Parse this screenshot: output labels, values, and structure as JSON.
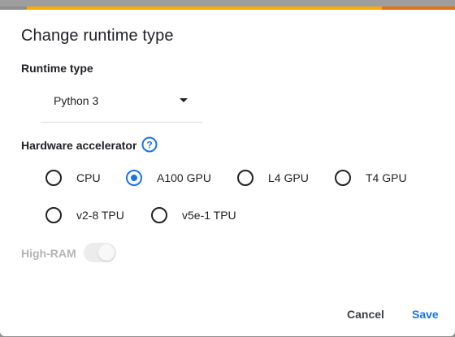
{
  "dialog": {
    "title": "Change runtime type",
    "runtime_label": "Runtime type",
    "runtime_value": "Python 3",
    "accelerator_label": "Hardware accelerator",
    "accelerators": [
      {
        "label": "CPU",
        "checked": false
      },
      {
        "label": "A100 GPU",
        "checked": true
      },
      {
        "label": "L4 GPU",
        "checked": false
      },
      {
        "label": "T4 GPU",
        "checked": false
      },
      {
        "label": "v2-8 TPU",
        "checked": false
      },
      {
        "label": "v5e-1 TPU",
        "checked": false
      }
    ],
    "high_ram_label": "High-RAM",
    "high_ram_enabled": false,
    "cancel_label": "Cancel",
    "save_label": "Save"
  },
  "colors": {
    "accent": "#1a73e8",
    "top_bar_yellow": "#f9ab00",
    "top_bar_orange": "#e8710a"
  },
  "icons": {
    "help": "help-circle-icon",
    "dropdown": "dropdown-arrow-icon"
  }
}
